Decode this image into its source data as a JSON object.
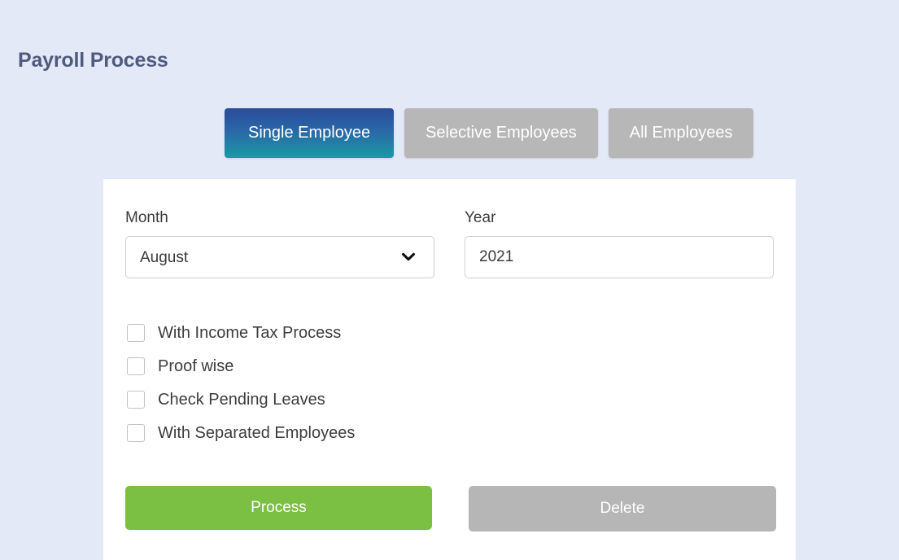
{
  "page": {
    "title": "Payroll Process",
    "background_color": "#e4e9f7",
    "title_color": "#4e5a7e"
  },
  "tabs": [
    {
      "label": "Single Employee",
      "active": true,
      "gradient_from": "#2b4c9b",
      "gradient_to": "#1a9aa5"
    },
    {
      "label": "Selective Employees",
      "active": false,
      "color": "#b7b7b7"
    },
    {
      "label": "All Employees",
      "active": false,
      "color": "#b7b7b7"
    }
  ],
  "form": {
    "month": {
      "label": "Month",
      "value": "August",
      "icon": "chevron-down-icon"
    },
    "year": {
      "label": "Year",
      "value": "2021",
      "placeholder": "Year"
    },
    "checkboxes": [
      {
        "label": "With Income Tax Process",
        "checked": false
      },
      {
        "label": "Proof wise",
        "checked": false
      },
      {
        "label": "Check Pending Leaves",
        "checked": false
      },
      {
        "label": "With Separated Employees",
        "checked": false
      }
    ]
  },
  "actions": {
    "process": {
      "label": "Process",
      "color": "#7bc043"
    },
    "delete": {
      "label": "Delete",
      "color": "#b6b6b6"
    }
  }
}
